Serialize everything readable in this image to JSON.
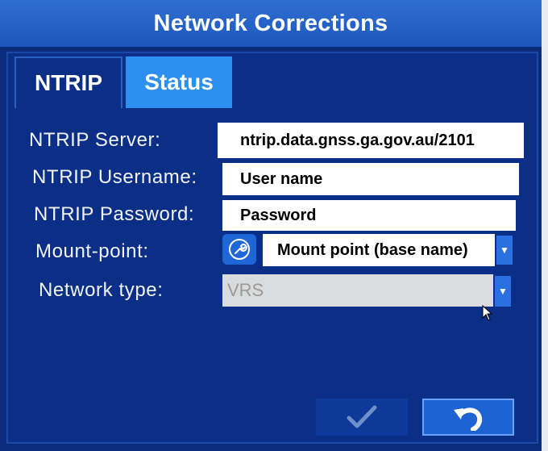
{
  "window": {
    "title": "Network Corrections"
  },
  "tabs": [
    {
      "label": "NTRIP",
      "active": true
    },
    {
      "label": "Status",
      "active": false
    }
  ],
  "form": {
    "server_label": "NTRIP Server:",
    "server_value": "ntrip.data.gnss.ga.gov.au/2101",
    "username_label": "NTRIP Username:",
    "username_value": "User name",
    "password_label": "NTRIP Password:",
    "password_value": "Password",
    "mountpoint_label": "Mount-point:",
    "mountpoint_value": "Mount point (base name)",
    "network_type_label": "Network type:",
    "network_type_value": "VRS"
  },
  "icons": {
    "mountpoint_tool": "wrench-icon",
    "ok": "checkmark-icon",
    "back": "undo-arrow-icon",
    "dropdown": "caret-down-icon"
  },
  "colors": {
    "title_bar": "#1d57bd",
    "panel": "#0b2f86",
    "active_tab_accent": "#2d8ff0",
    "field_bg": "#ffffff",
    "disabled_field_bg": "#d9dbdc"
  }
}
